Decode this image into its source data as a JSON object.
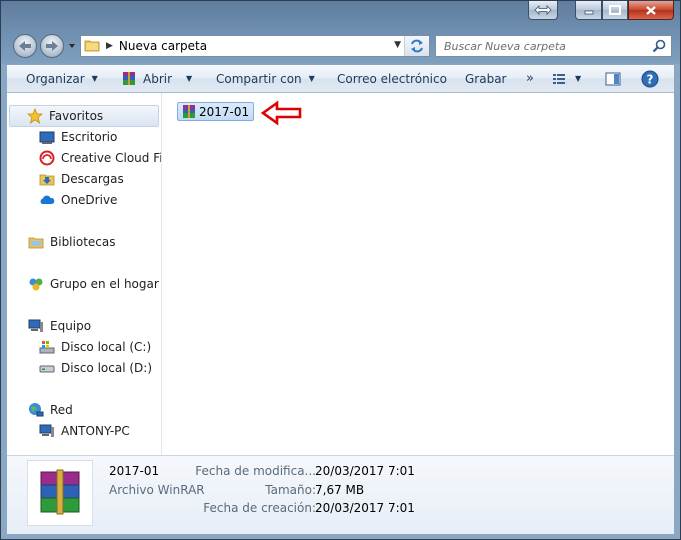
{
  "window": {
    "caption_buttons": [
      "restore-down",
      "minimize",
      "maximize",
      "close"
    ]
  },
  "address_bar": {
    "crumb": "Nueva carpeta"
  },
  "search": {
    "placeholder": "Buscar Nueva carpeta"
  },
  "toolbar": {
    "organize": "Organizar",
    "open": "Abrir",
    "share": "Compartir con",
    "email": "Correo electrónico",
    "burn": "Grabar",
    "more": "»"
  },
  "nav": {
    "favorites": "Favoritos",
    "favorites_items": [
      "Escritorio",
      "Creative Cloud File",
      "Descargas",
      "OneDrive"
    ],
    "libraries": "Bibliotecas",
    "homegroup": "Grupo en el hogar",
    "computer": "Equipo",
    "computer_items": [
      "Disco local (C:)",
      "Disco local (D:)"
    ],
    "network": "Red",
    "network_items": [
      "ANTONY-PC"
    ]
  },
  "files": [
    {
      "name": "2017-01",
      "icon": "winrar-archive-icon",
      "selected": true
    }
  ],
  "details": {
    "name": "2017-01",
    "type": "Archivo WinRAR",
    "modified_label": "Fecha de modifica...",
    "modified_value": "20/03/2017 7:01",
    "size_label": "Tamaño:",
    "size_value": "7,67 MB",
    "created_label": "Fecha de creación:",
    "created_value": "20/03/2017 7:01"
  },
  "colors": {
    "accent": "#1e395b",
    "selection": "#c1dcf5",
    "annotation_arrow": "#e00000"
  }
}
